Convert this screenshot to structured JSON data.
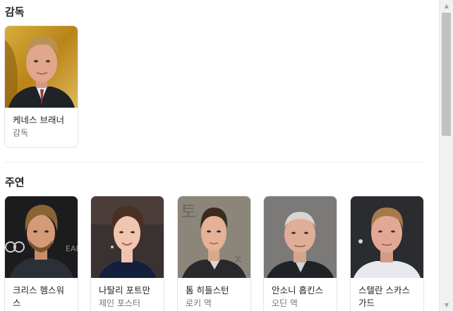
{
  "director_section": {
    "title": "감독",
    "cards": [
      {
        "name": "케네스 브래너",
        "role": "감독"
      }
    ]
  },
  "cast_section": {
    "title": "주연",
    "cards": [
      {
        "name": "크리스 헴스워스",
        "role": ""
      },
      {
        "name": "나탈리 포트만",
        "role": "제인 포스터"
      },
      {
        "name": "톰 히들스턴",
        "role": "로키 역"
      },
      {
        "name": "안소니 홉킨스",
        "role": "오딘 역"
      },
      {
        "name": "스텔란 스카스가드",
        "role": ""
      }
    ]
  },
  "colors": {
    "text_primary": "#202124",
    "text_secondary": "#70757a",
    "card_border": "#e4e4e4"
  },
  "scrollbar": {
    "up_icon": "scroll-up-arrow-icon",
    "down_icon": "scroll-down-arrow-icon"
  }
}
